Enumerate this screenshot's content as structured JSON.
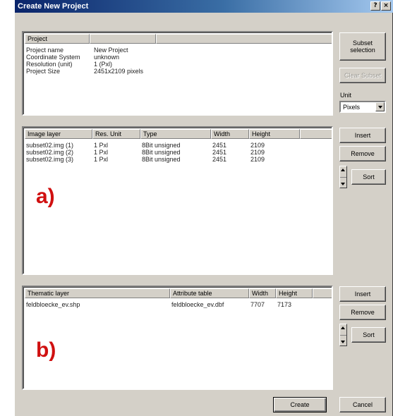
{
  "window": {
    "title": "Create New Project",
    "help_glyph": "?",
    "close_glyph": "×"
  },
  "project_panel": {
    "header": "Project",
    "rows": [
      {
        "label": "Project name",
        "value": "New Project"
      },
      {
        "label": "Coordinate System",
        "value": "unknown"
      },
      {
        "label": "Resolution (unit)",
        "value": "1 (Pxl)"
      },
      {
        "label": "Project Size",
        "value": "2451x2109 pixels"
      }
    ]
  },
  "image_panel": {
    "columns": [
      "Image layer",
      "Res. Unit",
      "Type",
      "Width",
      "Height"
    ],
    "rows": [
      [
        "subset02.img (1)",
        "1 Pxl",
        "8Bit unsigned",
        "2451",
        "2109"
      ],
      [
        "subset02.img (2)",
        "1 Pxl",
        "8Bit unsigned",
        "2451",
        "2109"
      ],
      [
        "subset02.img (3)",
        "1 Pxl",
        "8Bit unsigned",
        "2451",
        "2109"
      ]
    ],
    "annotation": "a)"
  },
  "thematic_panel": {
    "columns": [
      "Thematic layer",
      "Attribute table",
      "Width",
      "Height"
    ],
    "rows": [
      [
        "feldbloecke_ev.shp",
        "feldbloecke_ev.dbf",
        "7707",
        "7173"
      ]
    ],
    "annotation": "b)"
  },
  "side_buttons": {
    "subset_line1": "Subset",
    "subset_line2": "selection",
    "clear_subset": "Clear Subset",
    "unit_label": "Unit",
    "unit_value": "Pixels",
    "insert": "Insert",
    "remove": "Remove",
    "sort": "Sort",
    "insert2": "Insert",
    "remove2": "Remove",
    "sort2": "Sort"
  },
  "footer": {
    "create": "Create",
    "cancel": "Cancel"
  }
}
